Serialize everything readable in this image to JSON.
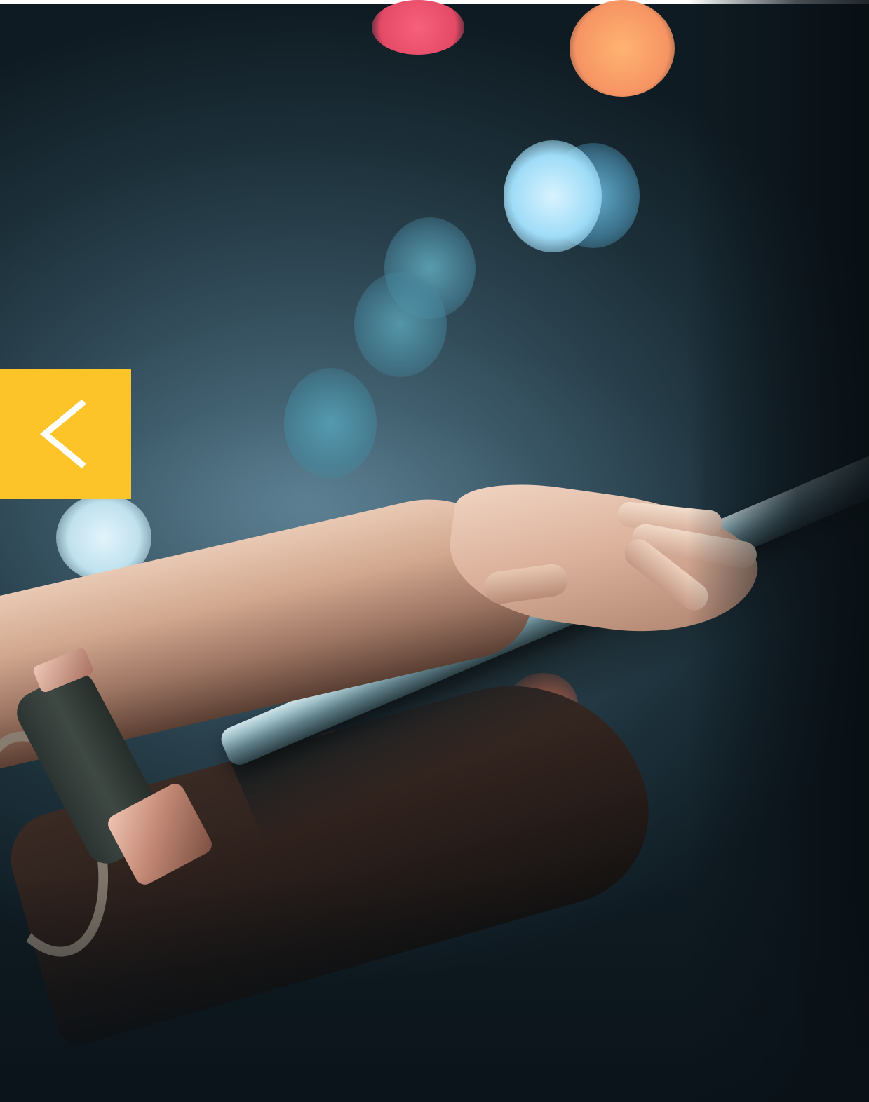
{
  "slider": {
    "previous_control": {
      "icon": "chevron-left-icon",
      "background_color": "#fdc429",
      "icon_color": "#ffffff"
    }
  }
}
